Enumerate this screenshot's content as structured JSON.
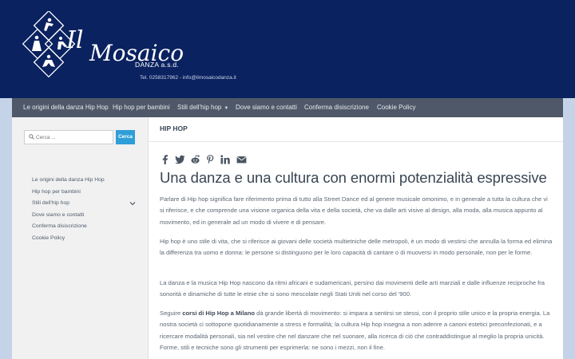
{
  "brand": {
    "logo_script": "Il Mosaico",
    "logo_sub": "DANZA a.s.d.",
    "contact": "Tel. 0258317962   -   info@ilmosaicodanza.it"
  },
  "colors": {
    "header": "#0b2260",
    "nav": "#4e5868",
    "accent": "#2f9ed8",
    "page_bg": "#c5d3e8"
  },
  "nav": {
    "items": [
      {
        "label": "Le origini della danza Hip Hop"
      },
      {
        "label": "Hip hop per bambini"
      },
      {
        "label": "Stili dell'hip hop",
        "has_dropdown": true
      },
      {
        "label": "Dove siamo e contatti"
      },
      {
        "label": "Conferma disiscrizione"
      },
      {
        "label": "Cookie Policy"
      }
    ]
  },
  "sidebar": {
    "search_placeholder": "Cerca ...",
    "search_button": "Cerca",
    "items": [
      {
        "label": "Le origini della danza Hip Hop"
      },
      {
        "label": "Hip hop per bambini"
      },
      {
        "label": "Stili dell'hip hop",
        "has_children": true
      },
      {
        "label": "Dove siamo e contatti"
      },
      {
        "label": "Conferma disiscrizione"
      },
      {
        "label": "Cookie Policy"
      }
    ]
  },
  "content": {
    "section": "HIP HOP",
    "share_icons": [
      "facebook-icon",
      "twitter-icon",
      "reddit-icon",
      "pinterest-icon",
      "linkedin-icon",
      "email-icon"
    ],
    "title": "Una danza e una cultura con enormi potenzialità espressive",
    "p1": "Parlare di Hip hop significa fare riferimento prima di tutto alla Street Dance ed al genere musicale omonimo, e  in generale a tutta la cultura che vi si riferisce, e che comprende una visione organica della vita e della società, che va dalle arti visive  al design, alla moda, alla musica appunto al movimento, ed in generale ad un modo di vivere e di pensare.",
    "p2": "Hip hop è uno stile di vita, che si riferisce ai giovani delle società multietniche delle metropoli, è un modo di vestirsi che annulla la forma ed elimina la differenza tra uomo e donna: le persone si distinguono per le loro capacità di cantare o di muoversi in modo personale, non per le forme.",
    "p3": "La danza e la musica Hip Hop nascono da ritmi africani e sudamericani, persino dai movimenti delle arti marziali e dalle influenze reciproche fra sonorità e dinamiche di tutte le etnie che si sono mescolate negli Stati Uniti nel corso del '900.",
    "p4_pre": "Seguire ",
    "p4_bold": "corsi di Hip Hop a Milano",
    "p4_post": " dà grande libertà di movimento: si impara a sentirsi se stessi, con il proprio stile unico e la propria energia. La nostra società ci sottopone quotidianamente a stress e formalità; la cultura Hip hop insegna a non aderire a canoni estetici preconfezionati, e a ricercare modalità personali, sia nel vestire che nel danzare che nel suonare, alla ricerca di ciò che contraddistingue al meglio la propria unicità. Forme, stili e tecniche sono gli strumenti per esprimerla: ne sono i mezzi, non il fine."
  }
}
